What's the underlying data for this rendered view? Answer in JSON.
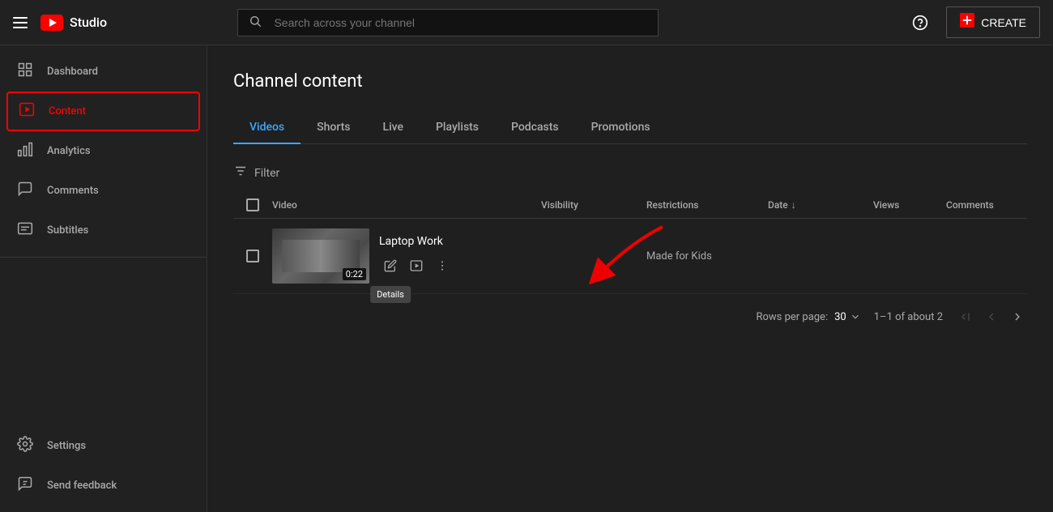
{
  "topNav": {
    "logoText": "Studio",
    "searchPlaceholder": "Search across your channel",
    "helpTooltip": "Help",
    "createLabel": "CREATE"
  },
  "sidebar": {
    "items": [
      {
        "id": "dashboard",
        "label": "Dashboard",
        "icon": "⊞",
        "active": false
      },
      {
        "id": "content",
        "label": "Content",
        "icon": "▶",
        "active": true
      },
      {
        "id": "analytics",
        "label": "Analytics",
        "icon": "📊",
        "active": false
      },
      {
        "id": "comments",
        "label": "Comments",
        "icon": "💬",
        "active": false
      },
      {
        "id": "subtitles",
        "label": "Subtitles",
        "icon": "≡",
        "active": false
      }
    ],
    "bottomItems": [
      {
        "id": "settings",
        "label": "Settings",
        "icon": "⚙"
      },
      {
        "id": "feedback",
        "label": "Send feedback",
        "icon": "⚑"
      }
    ]
  },
  "mainContent": {
    "pageTitle": "Channel content",
    "tabs": [
      {
        "id": "videos",
        "label": "Videos",
        "active": true
      },
      {
        "id": "shorts",
        "label": "Shorts",
        "active": false
      },
      {
        "id": "live",
        "label": "Live",
        "active": false
      },
      {
        "id": "playlists",
        "label": "Playlists",
        "active": false
      },
      {
        "id": "podcasts",
        "label": "Podcasts",
        "active": false
      },
      {
        "id": "promotions",
        "label": "Promotions",
        "active": false
      }
    ],
    "filterLabel": "Filter",
    "tableHeaders": {
      "video": "Video",
      "visibility": "Visibility",
      "restrictions": "Restrictions",
      "date": "Date",
      "views": "Views",
      "comments": "Comments"
    },
    "videos": [
      {
        "id": "laptop-work",
        "title": "Laptop Work",
        "duration": "0:22",
        "visibility": "",
        "restrictions": "Made for Kids",
        "date": "",
        "views": "",
        "comments": ""
      }
    ],
    "pagination": {
      "rowsPerPageLabel": "Rows per page:",
      "rowsPerPage": "30",
      "pageInfo": "1–1 of about 2"
    },
    "tooltip": {
      "detailsLabel": "Details"
    }
  }
}
